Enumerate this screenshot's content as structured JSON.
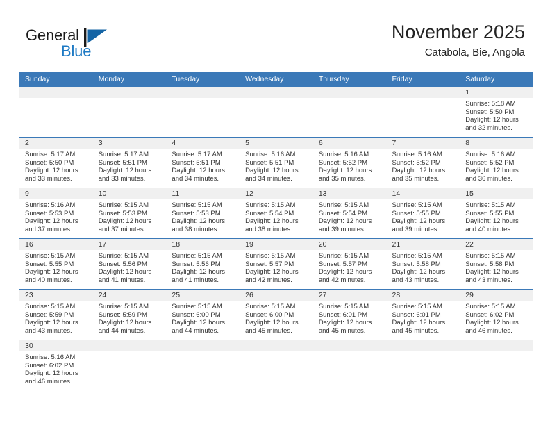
{
  "brand": {
    "name_part1": "General",
    "name_part2": "Blue",
    "flag_icon": "blue-flag-triangle-icon",
    "accent_color": "#1e7ac4"
  },
  "header": {
    "title": "November 2025",
    "subtitle": "Catabola, Bie, Angola"
  },
  "theme": {
    "header_blue": "#3b79b8",
    "day_band_gray": "#f0f0f0",
    "text_color": "#333333"
  },
  "weekdays": [
    "Sunday",
    "Monday",
    "Tuesday",
    "Wednesday",
    "Thursday",
    "Friday",
    "Saturday"
  ],
  "weeks": [
    [
      {
        "day": "",
        "sunrise": "",
        "sunset": "",
        "daylight": "",
        "empty": true
      },
      {
        "day": "",
        "sunrise": "",
        "sunset": "",
        "daylight": "",
        "empty": true
      },
      {
        "day": "",
        "sunrise": "",
        "sunset": "",
        "daylight": "",
        "empty": true
      },
      {
        "day": "",
        "sunrise": "",
        "sunset": "",
        "daylight": "",
        "empty": true
      },
      {
        "day": "",
        "sunrise": "",
        "sunset": "",
        "daylight": "",
        "empty": true
      },
      {
        "day": "",
        "sunrise": "",
        "sunset": "",
        "daylight": "",
        "empty": true
      },
      {
        "day": "1",
        "sunrise": "Sunrise: 5:18 AM",
        "sunset": "Sunset: 5:50 PM",
        "daylight": "Daylight: 12 hours and 32 minutes."
      }
    ],
    [
      {
        "day": "2",
        "sunrise": "Sunrise: 5:17 AM",
        "sunset": "Sunset: 5:50 PM",
        "daylight": "Daylight: 12 hours and 33 minutes."
      },
      {
        "day": "3",
        "sunrise": "Sunrise: 5:17 AM",
        "sunset": "Sunset: 5:51 PM",
        "daylight": "Daylight: 12 hours and 33 minutes."
      },
      {
        "day": "4",
        "sunrise": "Sunrise: 5:17 AM",
        "sunset": "Sunset: 5:51 PM",
        "daylight": "Daylight: 12 hours and 34 minutes."
      },
      {
        "day": "5",
        "sunrise": "Sunrise: 5:16 AM",
        "sunset": "Sunset: 5:51 PM",
        "daylight": "Daylight: 12 hours and 34 minutes."
      },
      {
        "day": "6",
        "sunrise": "Sunrise: 5:16 AM",
        "sunset": "Sunset: 5:52 PM",
        "daylight": "Daylight: 12 hours and 35 minutes."
      },
      {
        "day": "7",
        "sunrise": "Sunrise: 5:16 AM",
        "sunset": "Sunset: 5:52 PM",
        "daylight": "Daylight: 12 hours and 35 minutes."
      },
      {
        "day": "8",
        "sunrise": "Sunrise: 5:16 AM",
        "sunset": "Sunset: 5:52 PM",
        "daylight": "Daylight: 12 hours and 36 minutes."
      }
    ],
    [
      {
        "day": "9",
        "sunrise": "Sunrise: 5:16 AM",
        "sunset": "Sunset: 5:53 PM",
        "daylight": "Daylight: 12 hours and 37 minutes."
      },
      {
        "day": "10",
        "sunrise": "Sunrise: 5:15 AM",
        "sunset": "Sunset: 5:53 PM",
        "daylight": "Daylight: 12 hours and 37 minutes."
      },
      {
        "day": "11",
        "sunrise": "Sunrise: 5:15 AM",
        "sunset": "Sunset: 5:53 PM",
        "daylight": "Daylight: 12 hours and 38 minutes."
      },
      {
        "day": "12",
        "sunrise": "Sunrise: 5:15 AM",
        "sunset": "Sunset: 5:54 PM",
        "daylight": "Daylight: 12 hours and 38 minutes."
      },
      {
        "day": "13",
        "sunrise": "Sunrise: 5:15 AM",
        "sunset": "Sunset: 5:54 PM",
        "daylight": "Daylight: 12 hours and 39 minutes."
      },
      {
        "day": "14",
        "sunrise": "Sunrise: 5:15 AM",
        "sunset": "Sunset: 5:55 PM",
        "daylight": "Daylight: 12 hours and 39 minutes."
      },
      {
        "day": "15",
        "sunrise": "Sunrise: 5:15 AM",
        "sunset": "Sunset: 5:55 PM",
        "daylight": "Daylight: 12 hours and 40 minutes."
      }
    ],
    [
      {
        "day": "16",
        "sunrise": "Sunrise: 5:15 AM",
        "sunset": "Sunset: 5:55 PM",
        "daylight": "Daylight: 12 hours and 40 minutes."
      },
      {
        "day": "17",
        "sunrise": "Sunrise: 5:15 AM",
        "sunset": "Sunset: 5:56 PM",
        "daylight": "Daylight: 12 hours and 41 minutes."
      },
      {
        "day": "18",
        "sunrise": "Sunrise: 5:15 AM",
        "sunset": "Sunset: 5:56 PM",
        "daylight": "Daylight: 12 hours and 41 minutes."
      },
      {
        "day": "19",
        "sunrise": "Sunrise: 5:15 AM",
        "sunset": "Sunset: 5:57 PM",
        "daylight": "Daylight: 12 hours and 42 minutes."
      },
      {
        "day": "20",
        "sunrise": "Sunrise: 5:15 AM",
        "sunset": "Sunset: 5:57 PM",
        "daylight": "Daylight: 12 hours and 42 minutes."
      },
      {
        "day": "21",
        "sunrise": "Sunrise: 5:15 AM",
        "sunset": "Sunset: 5:58 PM",
        "daylight": "Daylight: 12 hours and 43 minutes."
      },
      {
        "day": "22",
        "sunrise": "Sunrise: 5:15 AM",
        "sunset": "Sunset: 5:58 PM",
        "daylight": "Daylight: 12 hours and 43 minutes."
      }
    ],
    [
      {
        "day": "23",
        "sunrise": "Sunrise: 5:15 AM",
        "sunset": "Sunset: 5:59 PM",
        "daylight": "Daylight: 12 hours and 43 minutes."
      },
      {
        "day": "24",
        "sunrise": "Sunrise: 5:15 AM",
        "sunset": "Sunset: 5:59 PM",
        "daylight": "Daylight: 12 hours and 44 minutes."
      },
      {
        "day": "25",
        "sunrise": "Sunrise: 5:15 AM",
        "sunset": "Sunset: 6:00 PM",
        "daylight": "Daylight: 12 hours and 44 minutes."
      },
      {
        "day": "26",
        "sunrise": "Sunrise: 5:15 AM",
        "sunset": "Sunset: 6:00 PM",
        "daylight": "Daylight: 12 hours and 45 minutes."
      },
      {
        "day": "27",
        "sunrise": "Sunrise: 5:15 AM",
        "sunset": "Sunset: 6:01 PM",
        "daylight": "Daylight: 12 hours and 45 minutes."
      },
      {
        "day": "28",
        "sunrise": "Sunrise: 5:15 AM",
        "sunset": "Sunset: 6:01 PM",
        "daylight": "Daylight: 12 hours and 45 minutes."
      },
      {
        "day": "29",
        "sunrise": "Sunrise: 5:15 AM",
        "sunset": "Sunset: 6:02 PM",
        "daylight": "Daylight: 12 hours and 46 minutes."
      }
    ],
    [
      {
        "day": "30",
        "sunrise": "Sunrise: 5:16 AM",
        "sunset": "Sunset: 6:02 PM",
        "daylight": "Daylight: 12 hours and 46 minutes."
      },
      {
        "day": "",
        "sunrise": "",
        "sunset": "",
        "daylight": "",
        "empty": true
      },
      {
        "day": "",
        "sunrise": "",
        "sunset": "",
        "daylight": "",
        "empty": true
      },
      {
        "day": "",
        "sunrise": "",
        "sunset": "",
        "daylight": "",
        "empty": true
      },
      {
        "day": "",
        "sunrise": "",
        "sunset": "",
        "daylight": "",
        "empty": true
      },
      {
        "day": "",
        "sunrise": "",
        "sunset": "",
        "daylight": "",
        "empty": true
      },
      {
        "day": "",
        "sunrise": "",
        "sunset": "",
        "daylight": "",
        "empty": true
      }
    ]
  ]
}
